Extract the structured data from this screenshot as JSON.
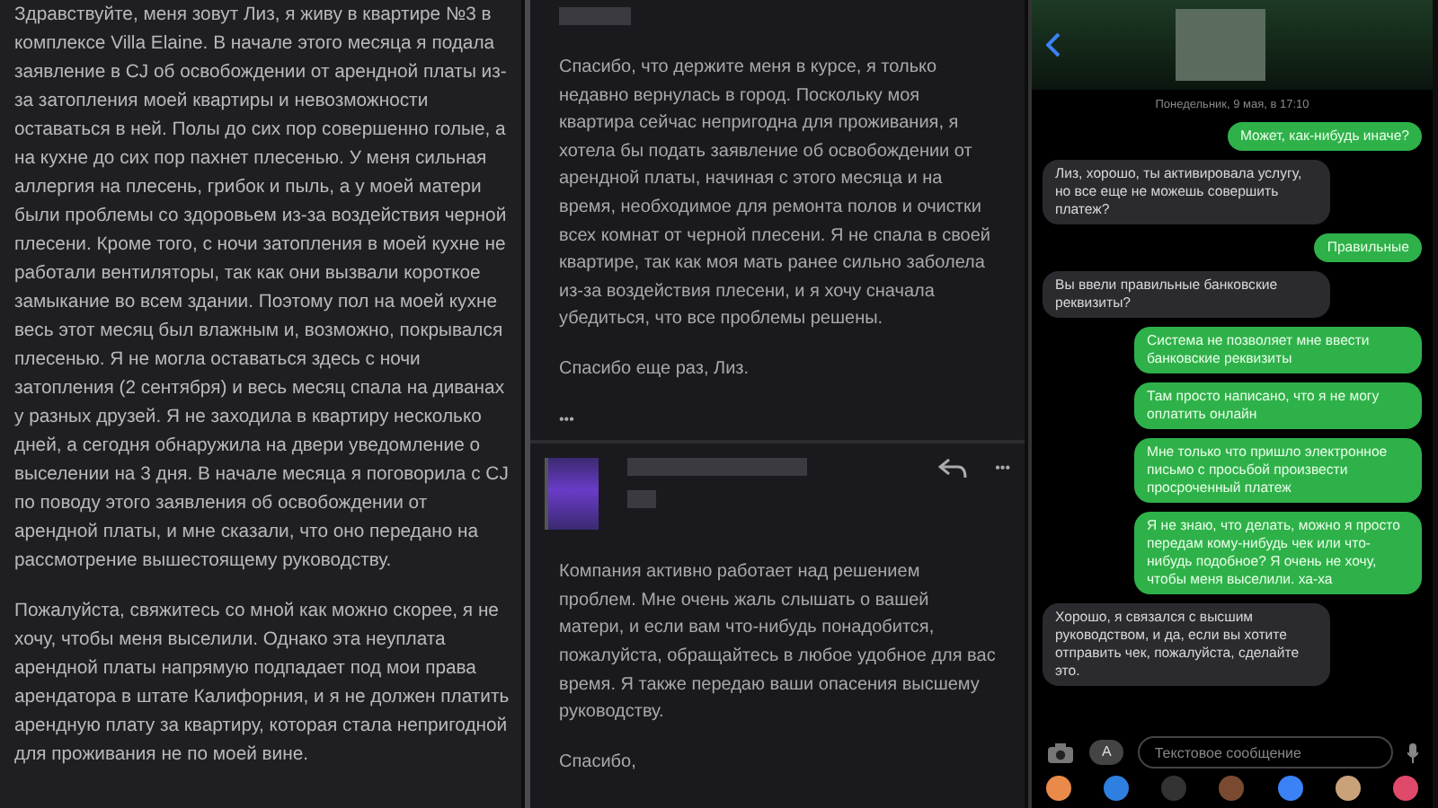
{
  "letter": {
    "paragraphs": [
      "Здравствуйте, меня зовут Лиз, я живу в квартире №3 в комплексе Villa Elaine. В начале этого месяца я подала заявление в CJ об освобождении от арендной платы из-за затопления моей квартиры и невозможности оставаться в ней. Полы до сих пор совершенно голые, а на кухне до сих пор пахнет плесенью. У меня сильная аллергия на плесень, грибок и пыль, а у моей матери были проблемы со здоровьем из-за воздействия черной плесени. Кроме того, с ночи затопления в моей кухне не работали вентиляторы, так как они вызвали короткое замыкание во всем здании. Поэтому пол на моей кухне весь этот месяц был влажным и, возможно, покрывался плесенью. Я не могла оставаться здесь с ночи затопления (2 сентября) и весь месяц спала на диванах у разных друзей. Я не заходила в квартиру несколько дней, а сегодня обнаружила на двери уведомление о выселении на 3 дня. В начале месяца я поговорила с CJ по поводу этого заявления об освобождении от арендной платы, и мне сказали, что оно передано на рассмотрение вышестоящему руководству.",
      "Пожалуйста, свяжитесь со мной как можно скорее, я не хочу, чтобы меня выселили. Однако эта неуплата арендной платы напрямую подпадает под мои права арендатора в штате Калифорния, и я не должен платить арендную плату за квартиру, которая стала непригодной для проживания не по моей вине."
    ]
  },
  "email_reply": {
    "paragraphs": [
      "Спасибо, что держите меня в курсе, я только недавно вернулась в город. Поскольку моя квартира сейчас непригодна для проживания, я хотела бы подать заявление об освобождении от арендной платы, начиная с этого месяца и на время, необходимое для ремонта полов и очистки всех комнат от черной плесени. Я не спала в своей квартире, так как моя мать ранее сильно заболела из-за воздействия плесени, и я хочу сначала убедиться, что все проблемы решены.",
      "Спасибо еще раз, Лиз."
    ],
    "collapsed_marker": "•••"
  },
  "email_message": {
    "paragraphs": [
      "Компания активно работает над решением проблем. Мне очень жаль слышать о вашей матери, и если вам что-нибудь понадобится, пожалуйста, обращайтесь в любое удобное для вас время. Я также передаю ваши опасения высшему руководству.",
      "Спасибо,"
    ],
    "more_marker": "•••"
  },
  "chat": {
    "timestamp": "Понедельник, 9 мая, в 17:10",
    "messages": [
      {
        "kind": "sent",
        "text": "Может, как-нибудь иначе?"
      },
      {
        "kind": "received",
        "text": "Лиз, хорошо, ты активировала услугу, но все еще не можешь совершить платеж?"
      },
      {
        "kind": "sent",
        "text": "Правильные"
      },
      {
        "kind": "received",
        "text": "Вы ввели правильные банковские реквизиты?"
      },
      {
        "kind": "sent",
        "text": "Система не позволяет мне ввести банковские реквизиты"
      },
      {
        "kind": "sent",
        "text": "Там просто написано, что я не могу оплатить онлайн"
      },
      {
        "kind": "sent",
        "text": "Мне только что пришло электронное письмо с просьбой произвести просроченный платеж"
      },
      {
        "kind": "sent",
        "text": "Я не знаю, что делать, можно я просто передам кому-нибудь чек или что-нибудь подобное? Я очень не хочу, чтобы меня выселили. ха-ха"
      },
      {
        "kind": "received",
        "text": "Хорошо, я связался с высшим руководством, и да, если вы хотите отправить чек, пожалуйста, сделайте это."
      }
    ],
    "apps_button": "A",
    "input": {
      "placeholder": "Текстовое сообщение"
    }
  }
}
